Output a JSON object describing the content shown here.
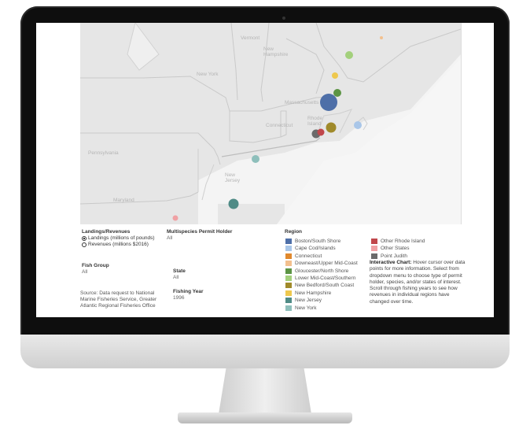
{
  "map": {
    "state_labels": [
      "Vermont",
      "New Hampshire",
      "New York",
      "Massachusetts",
      "Connecticut",
      "Rhode Island",
      "Pennsylvania",
      "New Jersey",
      "Maryland"
    ]
  },
  "controls": {
    "landings_revenues": {
      "heading": "Landings/Revenues",
      "options": [
        "Landings (millions of pounds)",
        "Revenues (millions $2016)"
      ],
      "selected_index": 0
    },
    "multispecies": {
      "heading": "Multispecies Permit Holder",
      "value": "All"
    },
    "fish_group": {
      "heading": "Fish Group",
      "value": "All"
    },
    "state": {
      "heading": "State",
      "value": "All"
    },
    "fishing_year": {
      "heading": "Fishing Year",
      "value": "1996"
    },
    "source": "Source: Data request to National Marine Fisheries Service, Greater Atlantic Regional Fisheries Office"
  },
  "region_legend": {
    "heading": "Region",
    "items": [
      {
        "label": "Boston/South Shore",
        "color": "#4e6fa8"
      },
      {
        "label": "Cape Cod/Islands",
        "color": "#a9c6e8"
      },
      {
        "label": "Connecticut",
        "color": "#e0892e"
      },
      {
        "label": "Downeast/Upper Mid-Coast",
        "color": "#f3c08e"
      },
      {
        "label": "Gloucester/North Shore",
        "color": "#5c9444"
      },
      {
        "label": "Lower Mid-Coast/Southern",
        "color": "#a3d07c"
      },
      {
        "label": "New Bedford/South Coast",
        "color": "#a08a2a"
      },
      {
        "label": "New Hampshire",
        "color": "#eec84e"
      },
      {
        "label": "New Jersey",
        "color": "#4f8b86"
      },
      {
        "label": "New York",
        "color": "#8ebfbb"
      },
      {
        "label": "Other Rhode Island",
        "color": "#c0474b"
      },
      {
        "label": "Other States",
        "color": "#f0a1a4"
      },
      {
        "label": "Point Judith",
        "color": "#6a6a6a"
      }
    ]
  },
  "note": {
    "bold": "Interactive Chart:",
    "text": " Hover cursor over data points for more information. Select from dropdown menu to choose type of permit holder, species, and/or states of interest. Scroll through fishing years to see how revenues in individual regions have changed over time."
  }
}
